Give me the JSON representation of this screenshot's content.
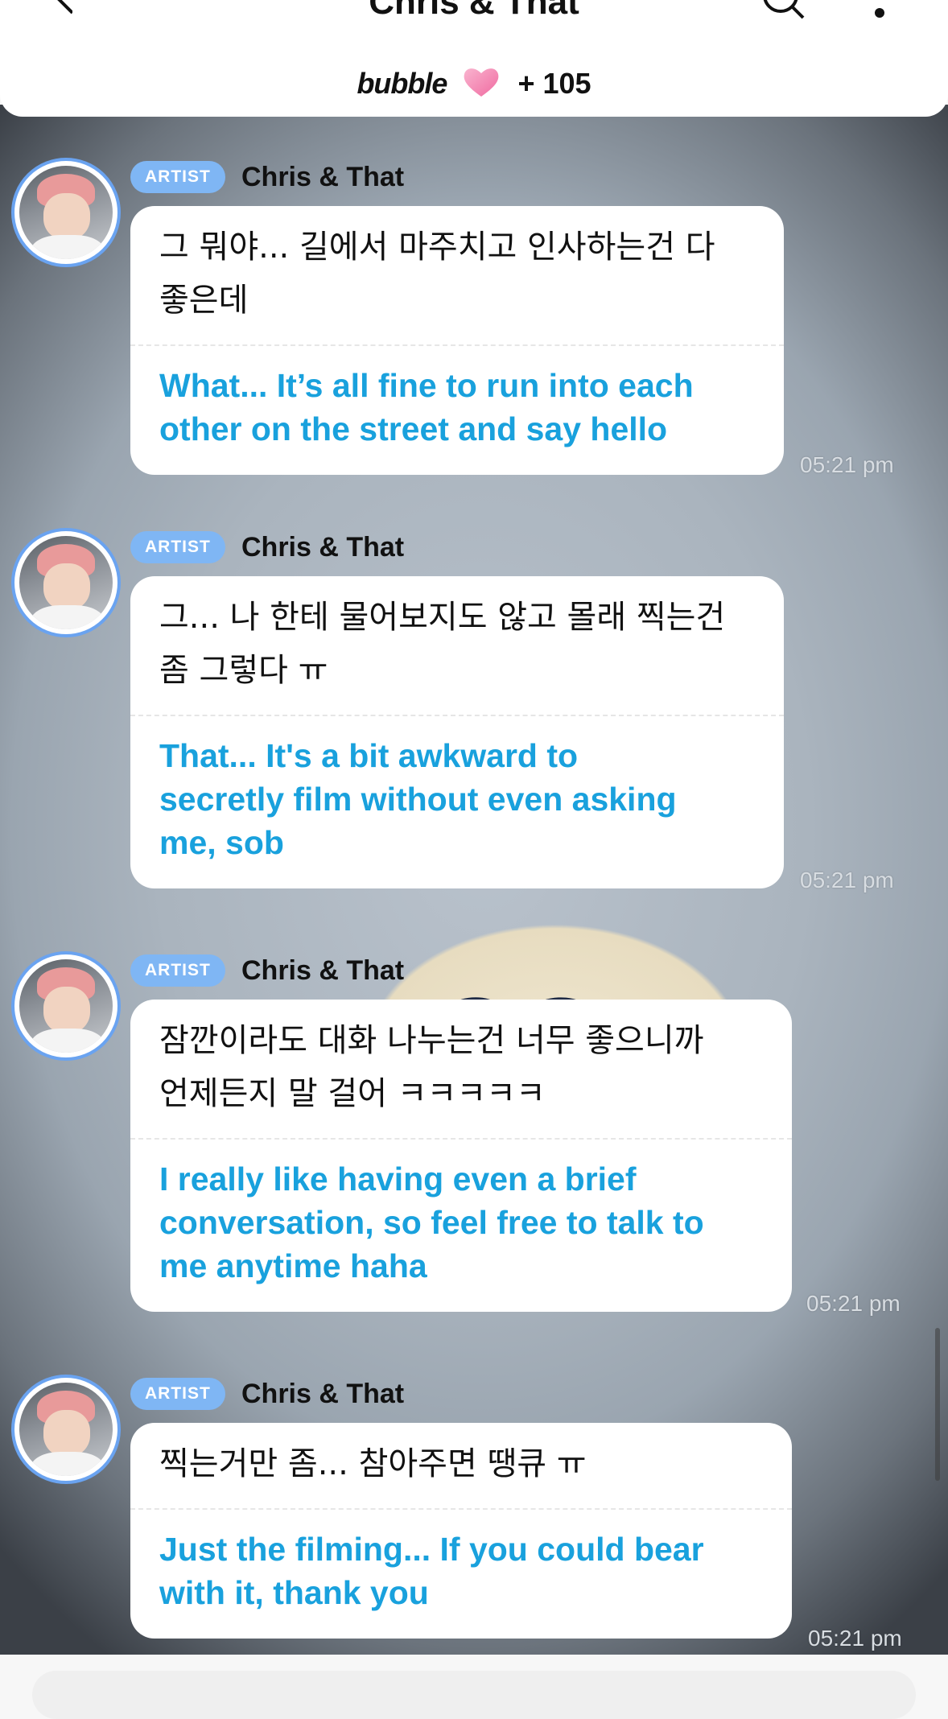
{
  "header": {
    "title": "Chris & That",
    "brand": "bubble",
    "count": "+ 105"
  },
  "messages": [
    {
      "badge": "ARTIST",
      "sender": "Chris & That",
      "ko_lines": [
        "그 뭐야... 길에서 마주치고 인사하는건 다",
        "좋은데"
      ],
      "en_lines": [
        "What... It’s all fine to run into each",
        "other on the street and say hello"
      ],
      "time": "05:21 pm"
    },
    {
      "badge": "ARTIST",
      "sender": "Chris & That",
      "ko_lines": [
        "그... 나 한테 물어보지도 않고 몰래 찍는건",
        "좀 그렇다 ㅠ"
      ],
      "en_lines": [
        "That... It's a bit awkward to",
        "secretly film without even asking",
        "me, sob"
      ],
      "time": "05:21 pm"
    },
    {
      "badge": "ARTIST",
      "sender": "Chris & That",
      "ko_lines": [
        "잠깐이라도 대화 나누는건 너무 좋으니까",
        "언제든지 말 걸어 ㅋㅋㅋㅋㅋ"
      ],
      "en_lines": [
        "I really like having even a brief",
        "conversation, so feel free to talk to",
        "me anytime haha"
      ],
      "time": "05:21 pm"
    },
    {
      "badge": "ARTIST",
      "sender": "Chris & That",
      "ko_lines": [
        "찍는거만 좀... 참아주면 땡큐 ㅠ"
      ],
      "en_lines": [
        "Just the filming... If you could bear",
        "with it, thank you"
      ],
      "time": "05:21 pm"
    }
  ]
}
